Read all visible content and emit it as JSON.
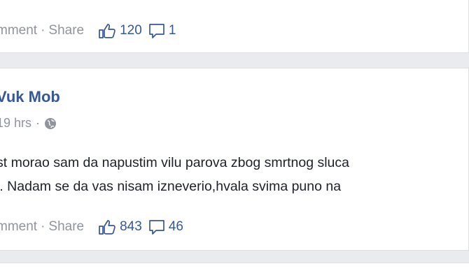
{
  "top_post": {
    "actions": {
      "comment_label": "mment",
      "separator": "·",
      "share_label": "Share",
      "likes": "120",
      "comments": "1"
    }
  },
  "post": {
    "author": "Vuk Mob",
    "timestamp": "19 hrs",
    "privacy_icon": "globe-icon",
    "separator": "·",
    "text_lines": [
      "st morao sam da napustim vilu parova zbog smrtnog sluca",
      "i. Nadam se da vas nisam izneverio,hvala svima puno na"
    ],
    "actions": {
      "comment_label": "mment",
      "separator": "·",
      "share_label": "Share",
      "likes": "843",
      "comments": "46"
    }
  },
  "colors": {
    "background": "#e9ebee",
    "card": "#ffffff",
    "link": "#365899",
    "meta": "#90949c",
    "text": "#1d2129"
  }
}
